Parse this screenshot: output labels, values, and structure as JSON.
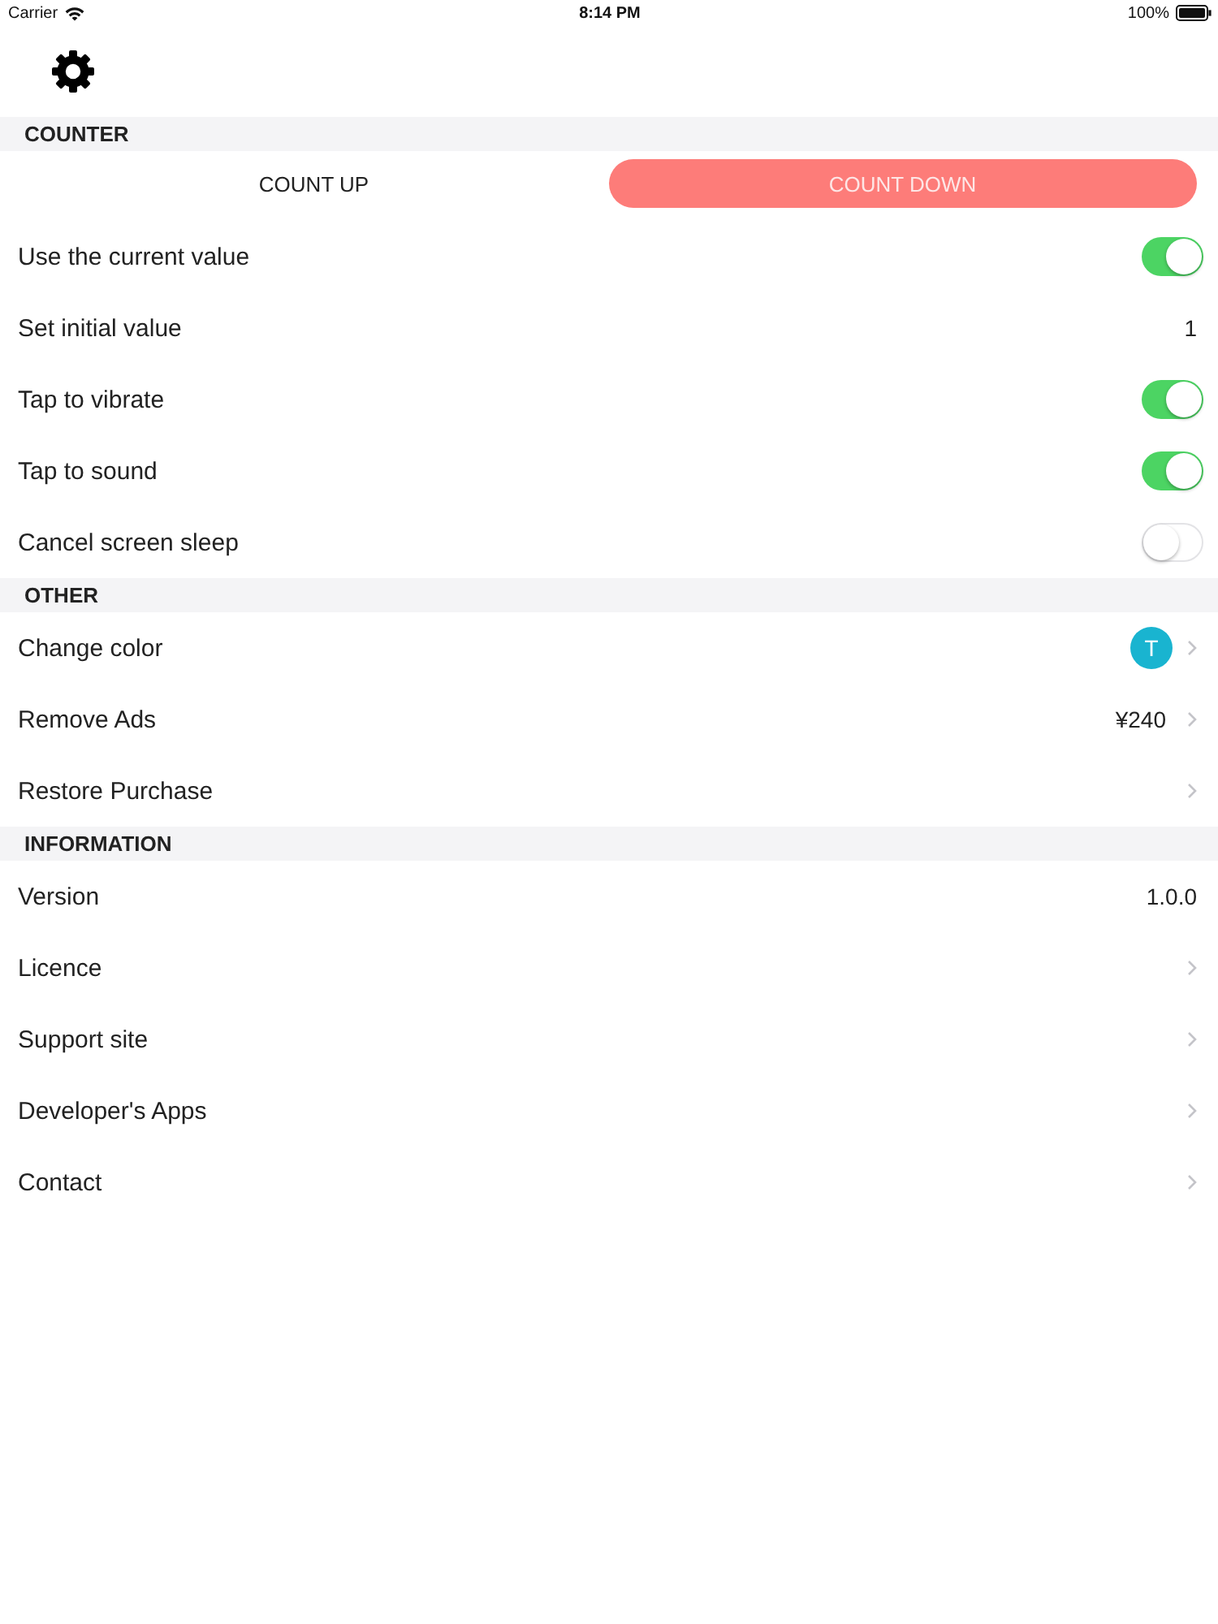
{
  "status_bar": {
    "carrier": "Carrier",
    "time": "8:14 PM",
    "battery": "100%"
  },
  "sections": [
    {
      "title": "COUNTER",
      "segments": [
        {
          "label": "COUNT UP",
          "selected": false
        },
        {
          "label": "COUNT DOWN",
          "selected": true
        }
      ],
      "rows": [
        {
          "kind": "toggle",
          "label": "Use the current value",
          "on": true
        },
        {
          "kind": "value",
          "label": "Set initial value",
          "value": "1"
        },
        {
          "kind": "toggle",
          "label": "Tap to vibrate",
          "on": true
        },
        {
          "kind": "toggle",
          "label": "Tap to sound",
          "on": true
        },
        {
          "kind": "toggle",
          "label": "Cancel screen sleep",
          "on": false
        }
      ]
    },
    {
      "title": "OTHER",
      "rows": [
        {
          "kind": "color",
          "label": "Change color",
          "swatch_letter": "T",
          "color": "#19b4d0"
        },
        {
          "kind": "link",
          "label": "Remove Ads",
          "value": "¥240"
        },
        {
          "kind": "link",
          "label": "Restore Purchase"
        }
      ]
    },
    {
      "title": "INFORMATION",
      "rows": [
        {
          "kind": "value",
          "label": "Version",
          "value": "1.0.0"
        },
        {
          "kind": "link",
          "label": "Licence"
        },
        {
          "kind": "link",
          "label": "Support site"
        },
        {
          "kind": "link",
          "label": "Developer's Apps"
        },
        {
          "kind": "link",
          "label": "Contact"
        }
      ]
    }
  ]
}
